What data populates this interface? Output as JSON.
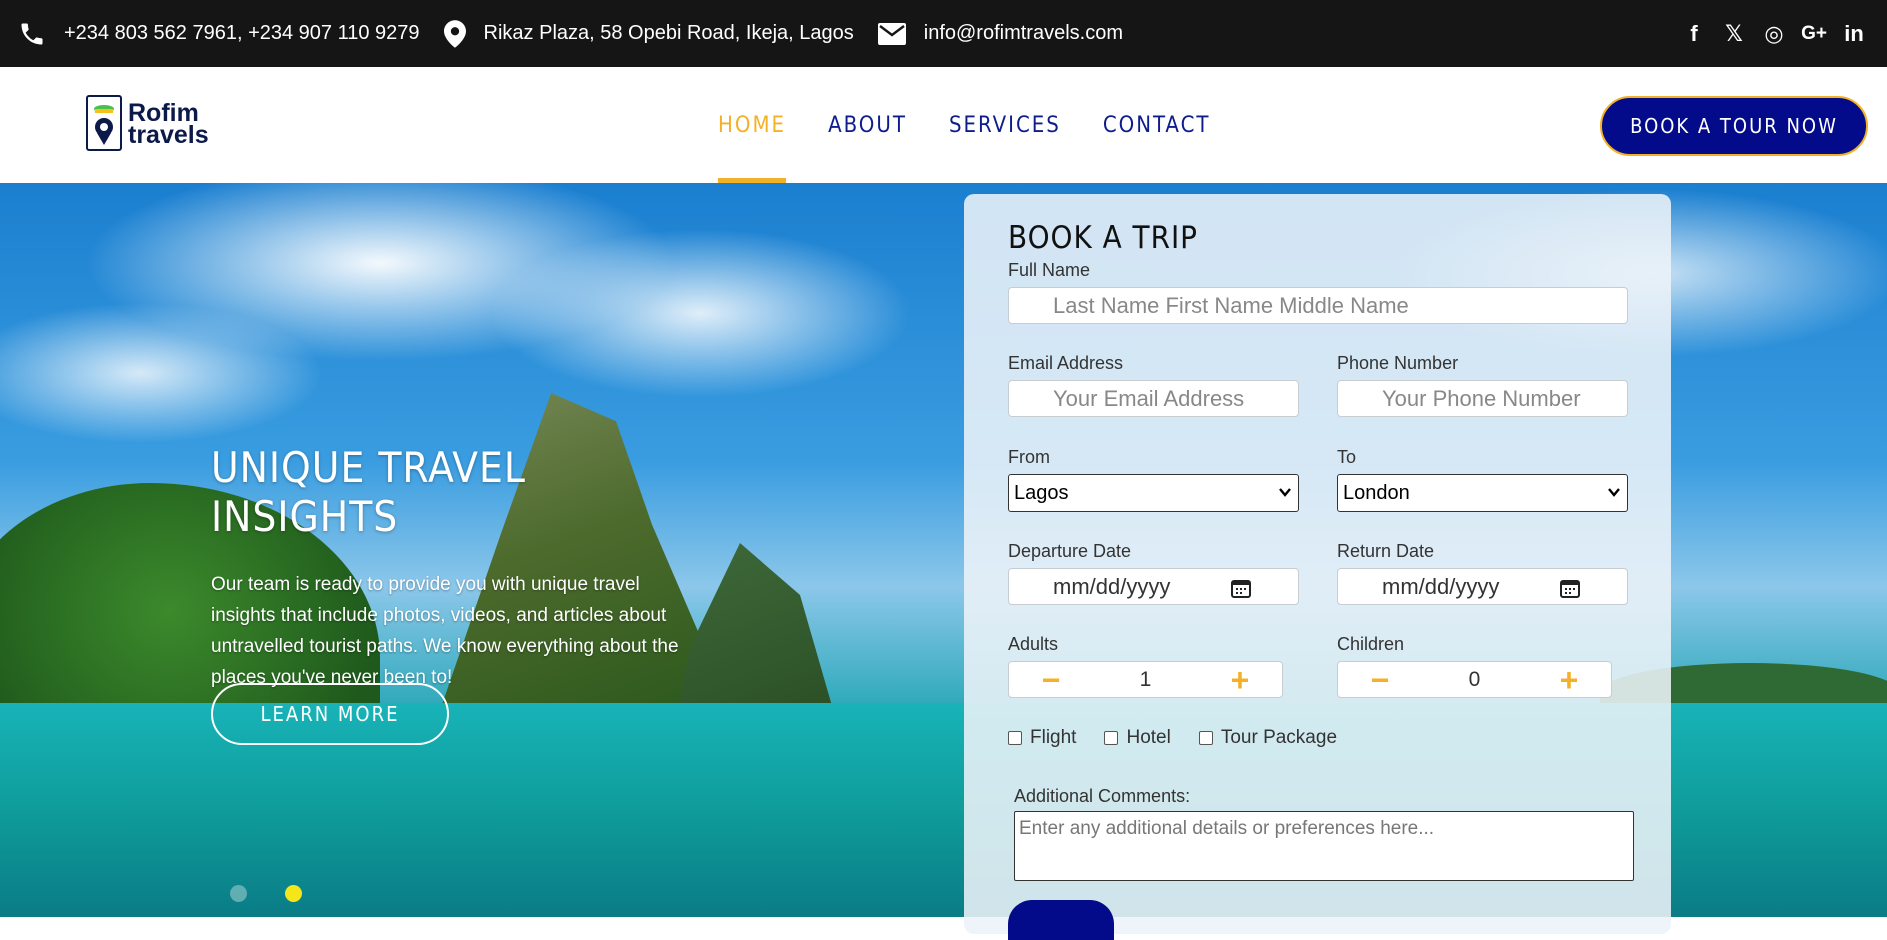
{
  "topbar": {
    "phone": "+234 803 562 7961, +234 907 110 9279",
    "address": "Rikaz Plaza, 58 Opebi Road, Ikeja, Lagos",
    "email": "info@rofimtravels.com",
    "socials": [
      {
        "name": "facebook",
        "glyph": "f"
      },
      {
        "name": "x-twitter",
        "glyph": "𝕏"
      },
      {
        "name": "instagram",
        "glyph": "◎"
      },
      {
        "name": "google-plus",
        "glyph": "G+"
      },
      {
        "name": "linkedin",
        "glyph": "in"
      }
    ]
  },
  "logo": {
    "line1": "Rofim",
    "line2": "travels"
  },
  "nav": {
    "items": [
      "HOME",
      "ABOUT",
      "SERVICES",
      "CONTACT"
    ],
    "active": "HOME",
    "cta": "BOOK A TOUR NOW"
  },
  "hero": {
    "title": "UNIQUE TRAVEL INSIGHTS",
    "text": "Our team is ready to provide you with unique travel insights that include photos, videos, and articles about untravelled tourist paths. We know everything about the places you've never been to!",
    "button": "LEARN MORE",
    "slide_count": 2,
    "active_slide": 2
  },
  "booking": {
    "title": "BOOK A TRIP",
    "full_name": {
      "label": "Full Name",
      "placeholder": "Last Name  First Name  Middle Name"
    },
    "email": {
      "label": "Email Address",
      "placeholder": "Your Email Address"
    },
    "phone": {
      "label": "Phone Number",
      "placeholder": "Your Phone Number"
    },
    "from": {
      "label": "From",
      "value": "Lagos"
    },
    "to": {
      "label": "To",
      "value": "London"
    },
    "departure": {
      "label": "Departure Date",
      "placeholder": "mm/dd/yyyy"
    },
    "return": {
      "label": "Return Date",
      "placeholder": "mm/dd/yyyy"
    },
    "adults": {
      "label": "Adults",
      "value": "1"
    },
    "children": {
      "label": "Children",
      "value": "0"
    },
    "options": [
      "Flight",
      "Hotel",
      "Tour Package"
    ],
    "comments": {
      "label": "Additional Comments:",
      "placeholder": "Enter any additional details or preferences here..."
    }
  },
  "colors": {
    "accent": "#f4b127",
    "primary": "#040b8a",
    "topbar": "#151515"
  }
}
